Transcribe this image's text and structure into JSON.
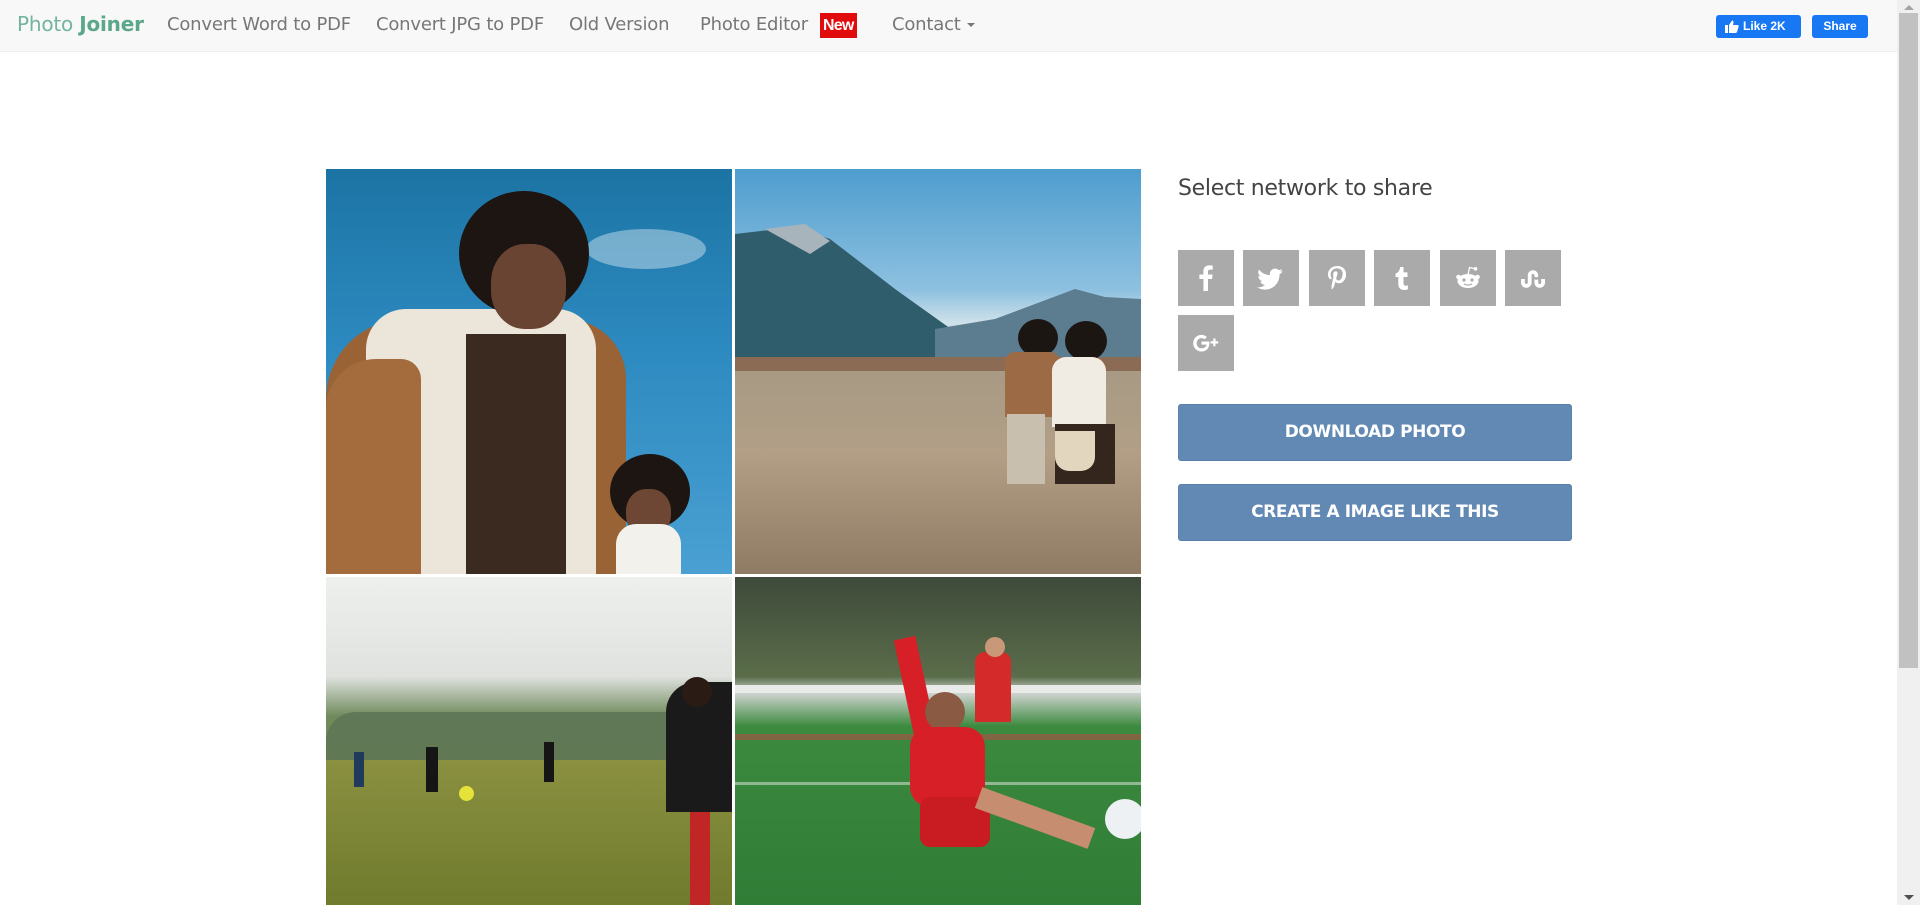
{
  "navbar": {
    "brand": {
      "part1": "Photo",
      "part2": "Joiner"
    },
    "links": [
      {
        "label": "Convert Word to PDF"
      },
      {
        "label": "Convert JPG to PDF"
      },
      {
        "label": "Old Version"
      },
      {
        "label": "Photo Editor"
      },
      {
        "label": "Contact"
      }
    ],
    "new_badge": "New",
    "facebook": {
      "like_label": "Like 2K",
      "share_label": "Share"
    }
  },
  "collage": {
    "photos": [
      {
        "description": "man in shearling jacket with woman, blue sky",
        "icon": "photo-icon"
      },
      {
        "description": "couple standing in dry grass field with mountains",
        "icon": "photo-icon"
      },
      {
        "description": "football players on misty field",
        "icon": "photo-icon"
      },
      {
        "description": "footballer in red kit kicking ball",
        "icon": "photo-icon"
      }
    ]
  },
  "share_panel": {
    "title": "Select network to share",
    "networks": [
      {
        "name": "Facebook",
        "icon": "facebook-icon"
      },
      {
        "name": "Twitter",
        "icon": "twitter-icon"
      },
      {
        "name": "Pinterest",
        "icon": "pinterest-icon"
      },
      {
        "name": "Tumblr",
        "icon": "tumblr-icon"
      },
      {
        "name": "Reddit",
        "icon": "reddit-icon"
      },
      {
        "name": "StumbleUpon",
        "icon": "stumbleupon-icon"
      },
      {
        "name": "Google+",
        "icon": "google-plus-icon"
      }
    ],
    "download_label": "DOWNLOAD PHOTO",
    "create_label": "CREATE A IMAGE LIKE THIS"
  },
  "colors": {
    "brand": "#5aa78a",
    "nav_text": "#777777",
    "badge": "#e10b0b",
    "facebook": "#1877f2",
    "social_icon_bg": "#aaaaaa",
    "action_button": "#6189b4"
  }
}
